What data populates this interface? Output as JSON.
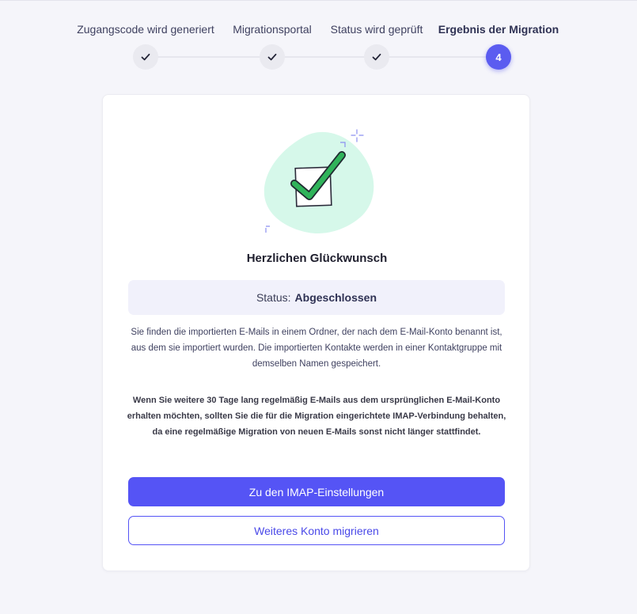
{
  "stepper": {
    "steps": [
      {
        "label": "Zugangscode wird generiert",
        "state": "done"
      },
      {
        "label": "Migrationsportal",
        "state": "done"
      },
      {
        "label": "Status wird geprüft",
        "state": "done"
      },
      {
        "label": "Ergebnis der Migration",
        "state": "active",
        "number": "4"
      }
    ],
    "accent_color": "#5b5cf0"
  },
  "result": {
    "title": "Herzlichen Glückwunsch",
    "status_label": "Status:",
    "status_value": "Abgeschlossen",
    "info_text": "Sie finden die importierten E-Mails in einem Ordner, der nach dem E-Mail-Konto benannt ist, aus dem sie importiert wurden. Die importierten Kontakte werden in einer Kontaktgruppe mit demselben Namen gespeichert.",
    "warning_text": "Wenn Sie weitere 30 Tage lang regelmäßig E-Mails aus dem ursprünglichen E-Mail-Konto erhalten möchten, sollten Sie die für die Migration eingerichtete IMAP-Verbindung behalten, da eine regelmäßige Migration von neuen E-Mails sonst nicht länger stattfindet.",
    "illustration_icon": "checkbox-success-icon"
  },
  "actions": {
    "primary_label": "Zu den IMAP-Einstellungen",
    "secondary_label": "Weiteres Konto migrieren"
  },
  "colors": {
    "primary_button": "#5554f5",
    "success_green": "#2fb35a",
    "illustration_blob": "#d6f8ea"
  }
}
